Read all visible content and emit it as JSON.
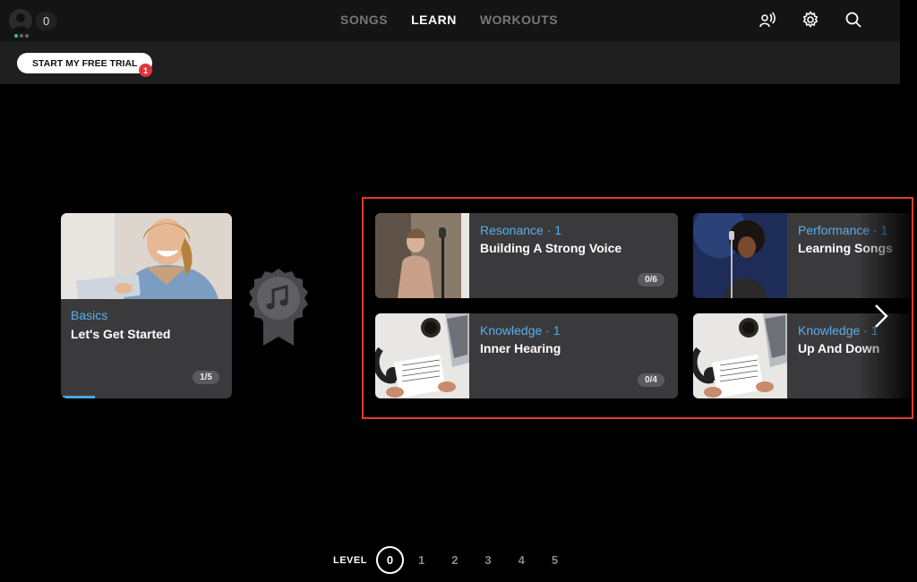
{
  "header": {
    "avatar_count": "0",
    "nav": [
      {
        "label": "SONGS"
      },
      {
        "label": "LEARN"
      },
      {
        "label": "WORKOUTS"
      }
    ],
    "icons": [
      "voice-icon",
      "gear-icon",
      "search-icon"
    ],
    "trial_button": "START MY FREE TRIAL",
    "trial_badge": "1"
  },
  "current_course": {
    "category": "Basics",
    "title": "Let's Get Started",
    "progress_text": "1/5",
    "progress_fraction": 0.2
  },
  "lessons": [
    {
      "category": "Resonance · 1",
      "title": "Building A Strong Voice",
      "progress": "0/6"
    },
    {
      "category": "Performance · 1",
      "title": "Learning Songs",
      "progress": ""
    },
    {
      "category": "Knowledge · 1",
      "title": "Inner Hearing",
      "progress": "0/4"
    },
    {
      "category": "Knowledge · 1",
      "title": "Up And Down",
      "progress": ""
    }
  ],
  "levels": {
    "label": "LEVEL",
    "current": "0",
    "others": [
      "1",
      "2",
      "3",
      "4",
      "5"
    ]
  },
  "colors": {
    "accent_blue": "#5aaee8",
    "highlight_red": "#e23a2d",
    "badge_red": "#e0353b",
    "status_green": "#3ec27f"
  }
}
